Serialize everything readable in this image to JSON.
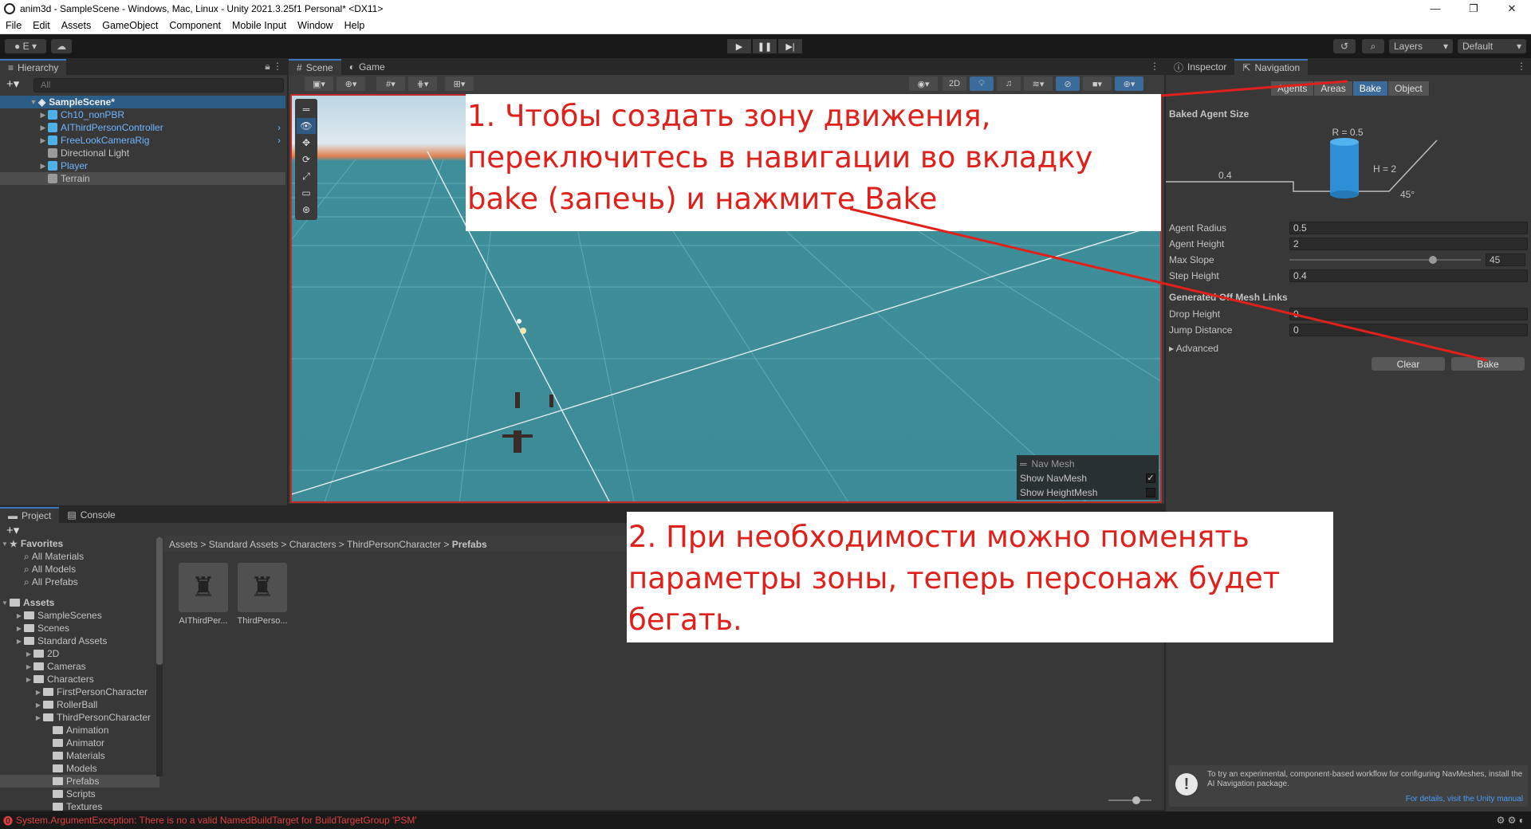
{
  "window": {
    "title": "anim3d - SampleScene - Windows, Mac, Linux - Unity 2021.3.25f1 Personal* <DX11>"
  },
  "menu": [
    "File",
    "Edit",
    "Assets",
    "GameObject",
    "Component",
    "Mobile Input",
    "Window",
    "Help"
  ],
  "toolbar": {
    "account_label": "E",
    "layers_label": "Layers",
    "layout_label": "Default"
  },
  "hierarchy": {
    "tab_label": "Hierarchy",
    "search_placeholder": "All",
    "scene_name": "SampleScene*",
    "items": [
      {
        "label": "Ch10_nonPBR",
        "style": "blue",
        "expand": true,
        "arrow_right": false
      },
      {
        "label": "AIThirdPersonController",
        "style": "blue",
        "expand": true,
        "arrow_right": true
      },
      {
        "label": "FreeLookCameraRig",
        "style": "blue",
        "expand": true,
        "arrow_right": true
      },
      {
        "label": "Directional Light",
        "style": "normal",
        "expand": false,
        "arrow_right": false
      },
      {
        "label": "Player",
        "style": "blue",
        "expand": true,
        "arrow_right": false
      },
      {
        "label": "Terrain",
        "style": "selected",
        "expand": false,
        "arrow_right": false
      }
    ]
  },
  "scene": {
    "tabs": [
      "Scene",
      "Game"
    ],
    "mode_2d": "2D",
    "navmesh_overlay": {
      "title": "Nav Mesh",
      "show_navmesh": "Show NavMesh",
      "show_navmesh_checked": true,
      "show_heightmesh": "Show HeightMesh",
      "show_heightmesh_checked": false
    }
  },
  "inspector": {
    "tabs": [
      "Inspector",
      "Navigation"
    ],
    "sub_tabs": [
      "Agents",
      "Areas",
      "Bake",
      "Object"
    ],
    "active_sub_tab": "Bake",
    "baked_agent_size_label": "Baked Agent Size",
    "diagram": {
      "radius_label": "R = 0.5",
      "height_label": "H = 2",
      "step_label": "0.4",
      "slope_label": "45°"
    },
    "fields": [
      {
        "label": "Agent Radius",
        "value": "0.5"
      },
      {
        "label": "Agent Height",
        "value": "2"
      },
      {
        "label": "Step Height",
        "value": "0.4"
      }
    ],
    "max_slope": {
      "label": "Max Slope",
      "value": "45",
      "fraction": 0.75
    },
    "offmesh_header": "Generated Off Mesh Links",
    "offmesh_fields": [
      {
        "label": "Drop Height",
        "value": "0"
      },
      {
        "label": "Jump Distance",
        "value": "0"
      }
    ],
    "advanced_label": "Advanced",
    "clear_button": "Clear",
    "bake_button": "Bake",
    "notice_text": "To try an experimental, component-based workflow for configuring NavMeshes, install the AI Navigation package.",
    "notice_link": "For details, visit the Unity manual"
  },
  "project": {
    "tabs": [
      "Project",
      "Console"
    ],
    "favorites_label": "Favorites",
    "favorites": [
      "All Materials",
      "All Models",
      "All Prefabs"
    ],
    "assets_label": "Assets",
    "tree": [
      {
        "label": "SampleScenes",
        "indent": 1
      },
      {
        "label": "Scenes",
        "indent": 1
      },
      {
        "label": "Standard Assets",
        "indent": 1
      },
      {
        "label": "2D",
        "indent": 2
      },
      {
        "label": "Cameras",
        "indent": 2
      },
      {
        "label": "Characters",
        "indent": 2
      },
      {
        "label": "FirstPersonCharacter",
        "indent": 3
      },
      {
        "label": "RollerBall",
        "indent": 3
      },
      {
        "label": "ThirdPersonCharacter",
        "indent": 3
      },
      {
        "label": "Animation",
        "indent": 4
      },
      {
        "label": "Animator",
        "indent": 4
      },
      {
        "label": "Materials",
        "indent": 4
      },
      {
        "label": "Models",
        "indent": 4
      },
      {
        "label": "Prefabs",
        "indent": 4
      },
      {
        "label": "Scripts",
        "indent": 4
      },
      {
        "label": "Textures",
        "indent": 4
      }
    ],
    "breadcrumb": [
      "Assets",
      "Standard Assets",
      "Characters",
      "ThirdPersonCharacter",
      "Prefabs"
    ],
    "assets": [
      "AIThirdPer...",
      "ThirdPerso..."
    ]
  },
  "status": {
    "error": "System.ArgumentException: There is no a valid NamedBuildTarget for BuildTargetGroup 'PSM'"
  },
  "annotations": {
    "step1": "1. Чтобы создать зону движения, переключитесь в навигации во вкладку bake (запечь)  и нажмите Bake",
    "step2": "2. При необходимости можно поменять параметры зоны, теперь персонаж будет бегать."
  },
  "colors": {
    "annotation_red": "#e0201b",
    "accent_blue": "#3a79bb",
    "link_blue": "#4a9df8",
    "terrain_teal": "#3c8b97"
  }
}
